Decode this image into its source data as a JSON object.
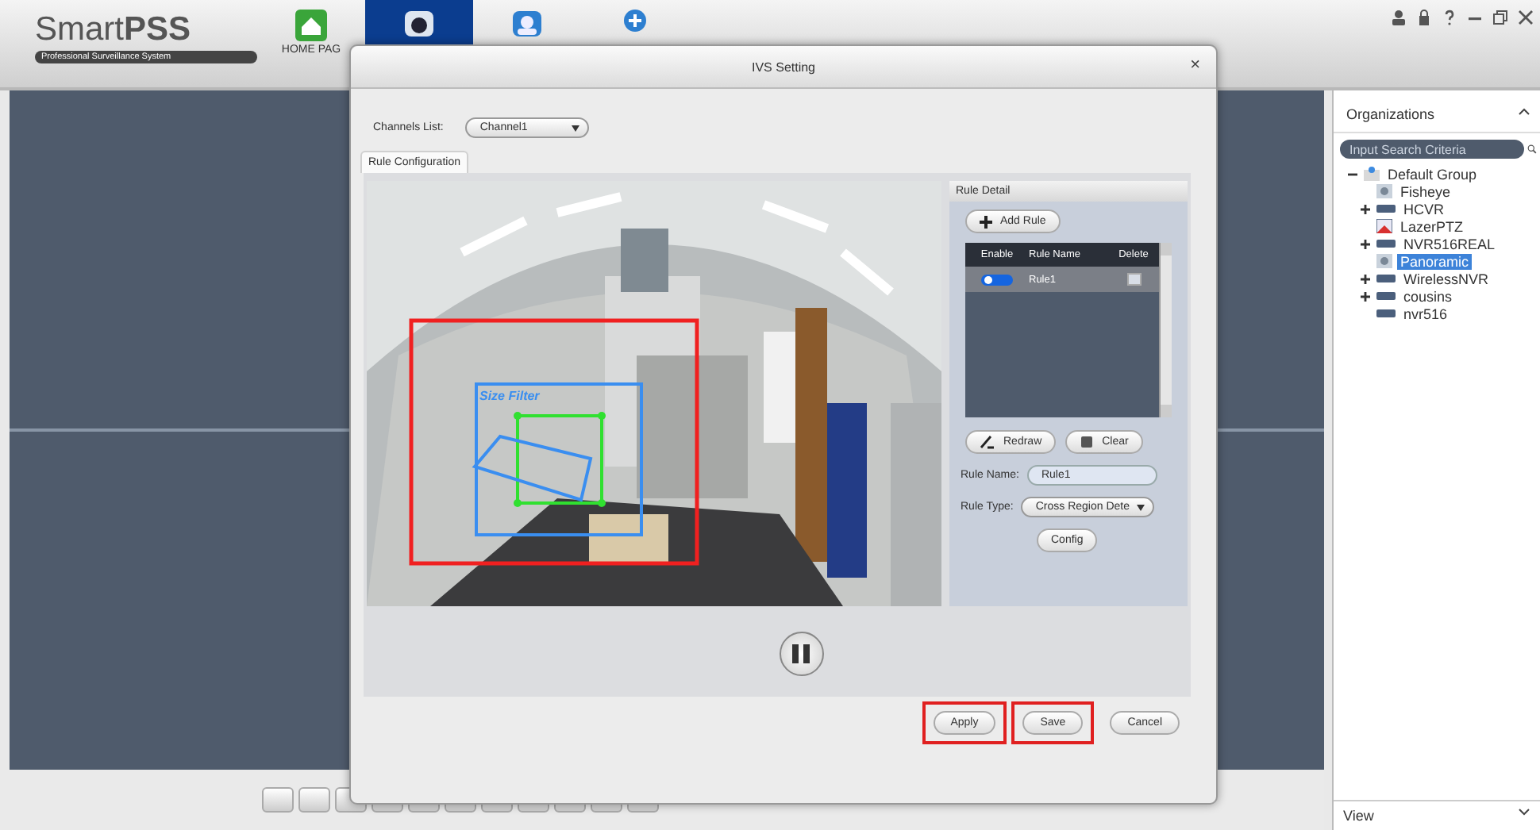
{
  "app": {
    "logo": "Smart**PSS**",
    "tagline": "Professional Surveillance System"
  },
  "tabs": [
    {
      "kind": "home",
      "label": "HOME PAG",
      "selected": false
    },
    {
      "kind": "camera",
      "selected": true
    },
    {
      "kind": "person",
      "selected": false
    },
    {
      "kind": "add",
      "selected": false
    }
  ],
  "dialog": {
    "title": "IVS Setting",
    "close": "×",
    "channels_label": "Channels List:",
    "channel": "Channel1",
    "tabs": [
      {
        "label": "Rule Configuration",
        "selected": true
      }
    ],
    "overlay": {
      "size_filter_label": "Size Filter"
    },
    "rule_detail": {
      "title": "Rule Detail",
      "add_button": "Add Rule",
      "columns": [
        "Enable",
        "Rule Name",
        "Delete"
      ],
      "rules": [
        {
          "enabled": true,
          "name": "Rule1"
        }
      ],
      "redraw_button": "Redraw",
      "clear_button": "Clear",
      "rule_name_label": "Rule Name:",
      "rule_name": "Rule1",
      "rule_type_label": "Rule Type:",
      "rule_type": "Cross Region Dete",
      "config_button": "Config"
    },
    "buttons": [
      {
        "label": "Apply",
        "highlighted": true
      },
      {
        "label": "Save",
        "highlighted": true
      },
      {
        "label": "Cancel",
        "highlighted": false
      }
    ]
  },
  "organizations": {
    "title": "Organizations",
    "search": {
      "placeholder": "Input Search Criteria"
    },
    "tree": [
      {
        "label": "Default Group",
        "kind": "group",
        "expanded": true,
        "selected": false,
        "children": [
          {
            "label": "Fisheye",
            "kind": "camera",
            "selected": false
          },
          {
            "label": "HCVR",
            "kind": "recorder",
            "expanded": false,
            "selected": false
          },
          {
            "label": "LazerPTZ",
            "kind": "ptz",
            "selected": false
          },
          {
            "label": "NVR516REAL",
            "kind": "recorder",
            "expanded": false,
            "selected": false
          },
          {
            "label": "Panoramic",
            "kind": "camera",
            "selected": true
          },
          {
            "label": "WirelessNVR",
            "kind": "recorder",
            "expanded": false,
            "selected": false
          },
          {
            "label": "cousins",
            "kind": "recorder",
            "expanded": false,
            "selected": false
          },
          {
            "label": "nvr516",
            "kind": "recorder",
            "selected": false
          }
        ]
      }
    ],
    "footer": "View"
  }
}
